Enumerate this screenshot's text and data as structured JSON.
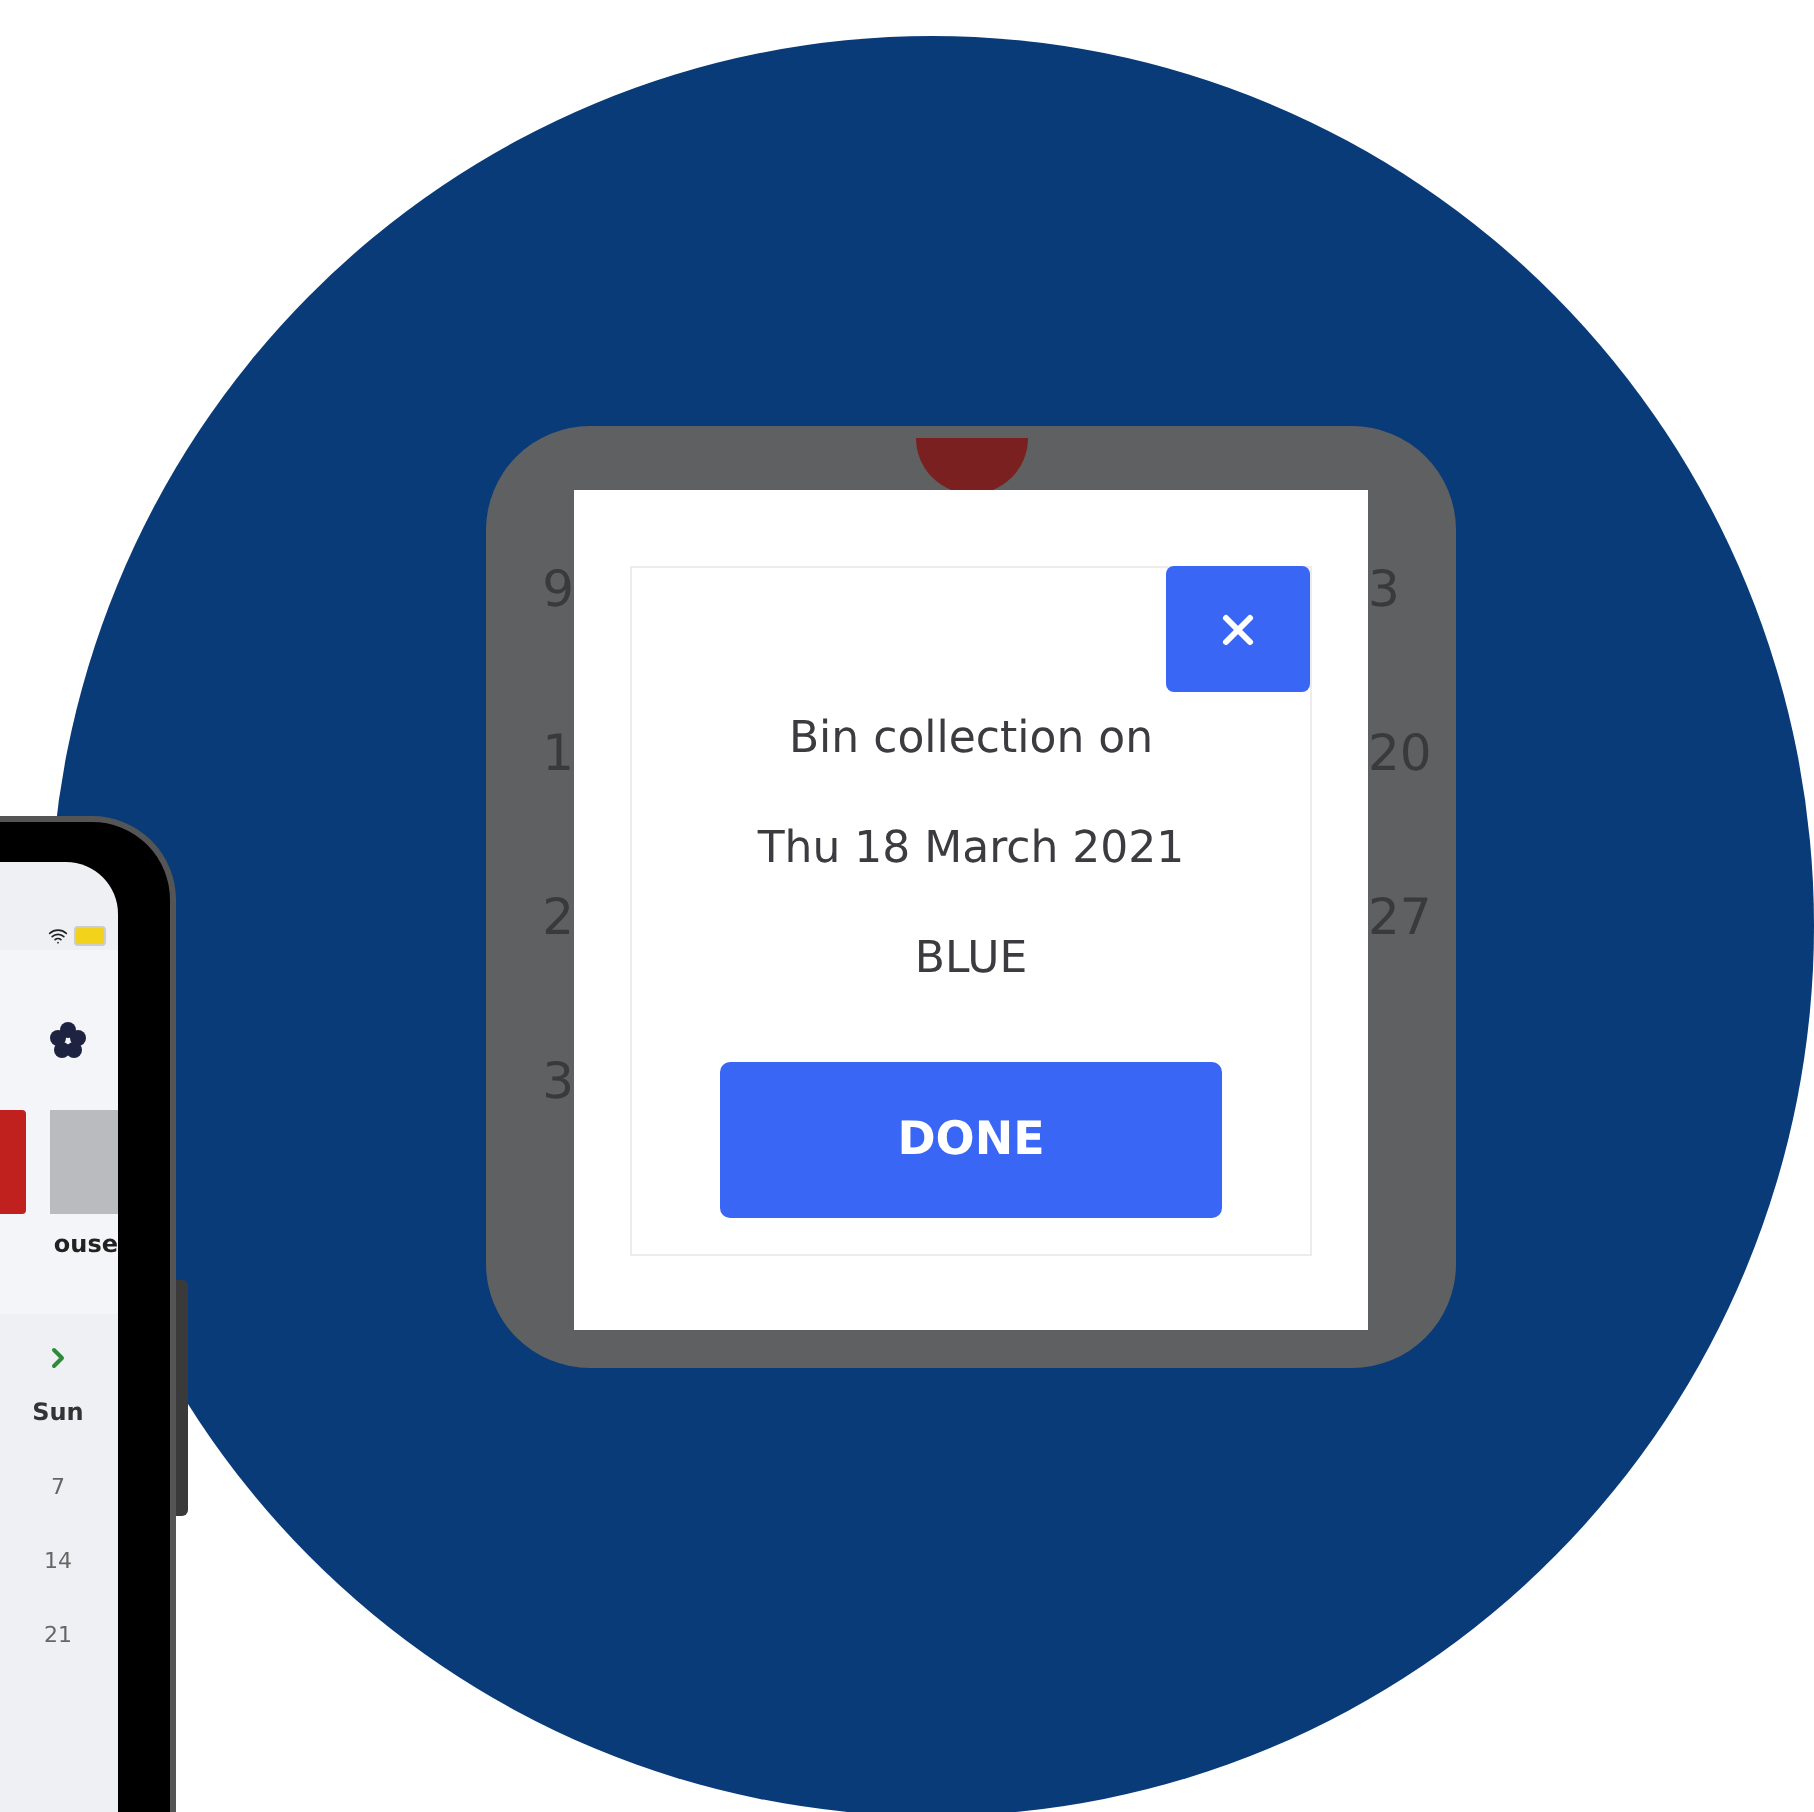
{
  "zoom_panel": {
    "left_dates": [
      "9",
      "1",
      "2",
      "3"
    ],
    "right_dates": [
      "3",
      "20",
      "27"
    ],
    "dialog": {
      "lines": [
        "Bin collection on",
        "Thu 18 March 2021",
        "BLUE"
      ],
      "done_label": "DONE"
    }
  },
  "phone": {
    "tab_label": "ouse",
    "weekday": "Sun",
    "dates": [
      "7",
      "14",
      "21"
    ]
  }
}
